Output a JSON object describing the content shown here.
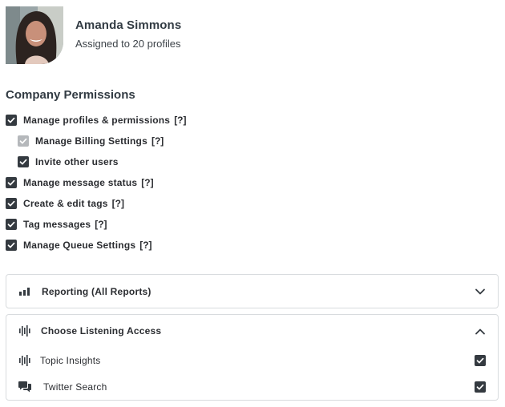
{
  "user": {
    "name": "Amanda Simmons",
    "subtitle": "Assigned to 20 profiles"
  },
  "company_permissions": {
    "title": "Company Permissions",
    "items": [
      {
        "label": "Manage profiles & permissions",
        "help": "[?]",
        "checked": true,
        "disabled": false,
        "indent": false
      },
      {
        "label": "Manage Billing Settings",
        "help": "[?]",
        "checked": true,
        "disabled": true,
        "indent": true
      },
      {
        "label": "Invite other users",
        "help": "",
        "checked": true,
        "disabled": false,
        "indent": true
      },
      {
        "label": "Manage message status",
        "help": "[?]",
        "checked": true,
        "disabled": false,
        "indent": false
      },
      {
        "label": "Create & edit tags",
        "help": "[?]",
        "checked": true,
        "disabled": false,
        "indent": false
      },
      {
        "label": "Tag messages",
        "help": "[?]",
        "checked": true,
        "disabled": false,
        "indent": false
      },
      {
        "label": "Manage Queue Settings",
        "help": "[?]",
        "checked": true,
        "disabled": false,
        "indent": false
      }
    ]
  },
  "reporting_panel": {
    "title": "Reporting (All Reports)",
    "icon": "bar-chart-icon",
    "expanded": false
  },
  "listening_panel": {
    "title": "Choose Listening Access",
    "icon": "audio-wave-icon",
    "expanded": true,
    "items": [
      {
        "label": "Topic Insights",
        "icon": "audio-wave-icon",
        "checked": true
      },
      {
        "label": "Twitter Search",
        "icon": "chat-bubbles-icon",
        "checked": true
      }
    ]
  },
  "colors": {
    "checkbox": "#343a40",
    "checkbox_disabled": "#b5b8bb",
    "border": "#d8dbde",
    "text": "#2b2d31"
  }
}
